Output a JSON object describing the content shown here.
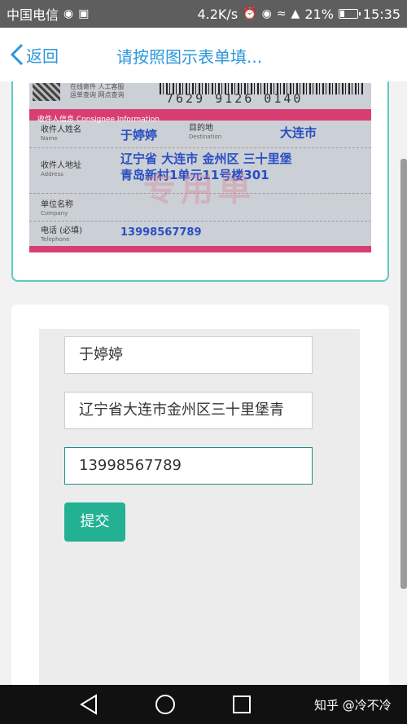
{
  "status_bar": {
    "carrier": "中国电信",
    "speed": "4.2K/s",
    "battery": "21%",
    "battery_level": 0.21,
    "time": "15:35"
  },
  "header": {
    "back_label": "返回",
    "title": "请按照图示表单填..."
  },
  "sample_photo": {
    "tracking_number": "7629 9126 0140",
    "header_small_1": "在线寄件 人工客服",
    "header_small_2": "运单查询 网点查询",
    "section_title": "收件人信息 Consignee Information",
    "name_label": "收件人姓名",
    "name_label_en": "Name",
    "name_value": "于婷婷",
    "destination_label": "目的地",
    "destination_label_en": "Destination",
    "destination_value": "大连市",
    "address_label": "收件人地址",
    "address_label_en": "Address",
    "address_line1": "辽宁省 大连市 金州区 三十里堡",
    "address_line2": "青岛新村1单元11号楼301",
    "company_label": "单位名称",
    "company_label_en": "Company",
    "phone_label": "电话 (必填)",
    "phone_label_en": "Telephone",
    "phone_value": "13998567789",
    "stamp_text": "专用单"
  },
  "form": {
    "name_value": "于婷婷",
    "address_value": "辽宁省大连市金州区三十里堡青",
    "phone_value": "13998567789",
    "submit_label": "提交"
  },
  "watermark": "知乎 @冷不冷"
}
